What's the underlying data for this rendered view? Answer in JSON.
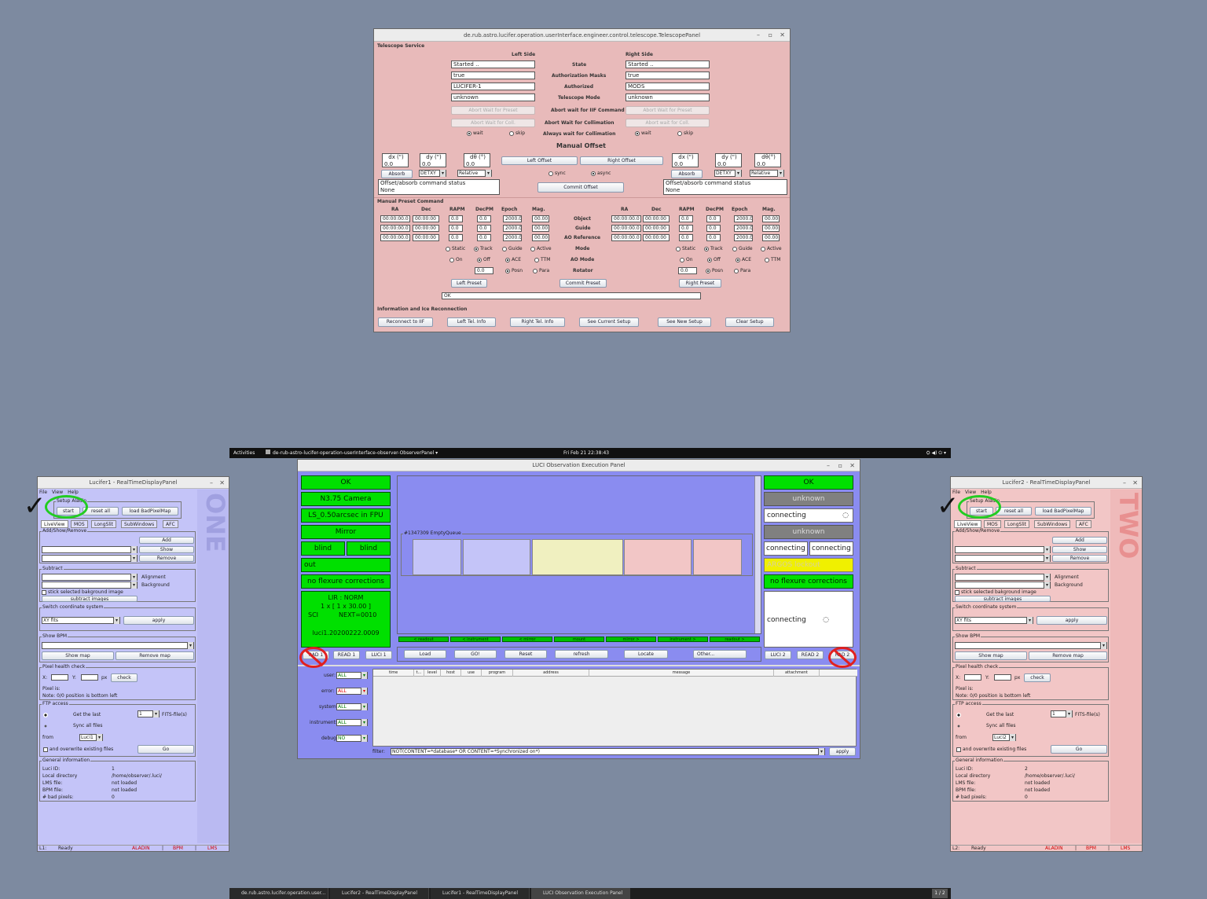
{
  "telescope": {
    "title": "de.rub.astro.lucifer.operation.userInterface.engineer.control.telescope.TelescopePanel",
    "service": "Telescope Service",
    "left_side": "Left Side",
    "right_side": "Right Side",
    "row_labels": [
      "State",
      "Authorization Masks",
      "Authorized",
      "Telescope Mode",
      "Abort wait for IIF Command",
      "Abort Wait for Collimation",
      "Always wait for Collimation"
    ],
    "left_values": [
      "Started ..",
      "true",
      "LUCIFER-1",
      "unknown"
    ],
    "right_values": [
      "Started ..",
      "true",
      "MODS",
      "unknown"
    ],
    "abort_preset": "Abort Wait for Preset",
    "abort_coll": "Abort Wait for Coll.",
    "abort_coll_r": "Abort wait for Coll.",
    "wait": "wait",
    "skip": "skip",
    "manual_offset": "Manual Offset",
    "dx": "dx (\")",
    "dy": "dy (\")",
    "dtheta": "dθ (°)",
    "dtheta_r": "dθ(°)",
    "zero": "0.0",
    "left_offset": "Left Offset",
    "right_offset": "Right Offset",
    "absorb": "Absorb",
    "detxy": "DETXY",
    "relative": "Relative",
    "sync": "sync",
    "async": "async",
    "commit_offset": "Commit Offset",
    "status_title": "Offset/absorb command status",
    "status_val": "None",
    "preset_title": "Manual Preset Command",
    "cols": [
      "RA",
      "Dec",
      "RAPM",
      "DecPM",
      "Epoch",
      "Mag."
    ],
    "rows": [
      "Object",
      "Guide",
      "AO Reference",
      "Mode",
      "AO Mode",
      "Rotator"
    ],
    "ra": "00:00:00.0",
    "dec": "00:00:00",
    "pm": "0.0",
    "epoch": "2000.0",
    "mag": "00.00",
    "modes": [
      "Static",
      "Track",
      "Guide",
      "Active"
    ],
    "aomodes": [
      "On",
      "Off",
      "ACE",
      "TTM"
    ],
    "rot": [
      "Posn",
      "Para"
    ],
    "left_preset": "Left Preset",
    "commit_preset": "Commit Preset",
    "right_preset": "Right Preset",
    "ok": "OK",
    "info_title": "Information and Ice Reconnection",
    "bottom": [
      "Reconnect to IIF",
      "Left Tel. Info",
      "Right Tel. Info",
      "See Current Setup",
      "See New Setup",
      "Clear Setup"
    ]
  },
  "topbar": {
    "activities": "Activities",
    "app": "de-rub-astro-lucifer-operation-userInterface-observer-ObserverPanel ▾",
    "clock": "Fri Feb 21  22:38:43",
    "icons": "⛭ ◀) ⏻ ▾"
  },
  "luci": {
    "title": "LUCI Observation Execution Panel",
    "left": {
      "ok": "OK",
      "camera": "N3.75 Camera",
      "mask": "LS_0.50arcsec in FPU",
      "mirror": "Mirror",
      "blind1": "blind",
      "blind2": "blind",
      "out": "out",
      "flexure": "no flexure corrections",
      "mode": "LIR : NORM",
      "exp": "1 x [ 1 x 30.00 ]",
      "sci": "SCI",
      "next": "NEXT=0010",
      "file": "luci1.20200222.0009"
    },
    "right": {
      "ok": "OK",
      "unknown1": "unknown",
      "connecting1": "connecting",
      "unknown2": "unknown",
      "connecting2": "connecting",
      "connecting3": "connecting",
      "argos": "ARGOS lockout",
      "flexure": "no flexure corrections",
      "connecting4": "connecting"
    },
    "queue": "#1347309 EmptyQueue",
    "bars": [
      "< readout",
      "< instrument",
      "< mirror",
      "mount",
      "mirror >",
      "instrument >",
      "readout >"
    ],
    "left_tabs": [
      "RAD 1",
      "READ 1",
      "LUCI 1"
    ],
    "right_tabs": [
      "LUCI 2",
      "READ 2",
      "RAD 2"
    ],
    "buttons": [
      "Load",
      "GO!",
      "Reset",
      "refresh",
      "Locate",
      "Other..."
    ],
    "log_filters": [
      {
        "label": "user:",
        "value": "ALL"
      },
      {
        "label": "error:",
        "value": "ALL"
      },
      {
        "label": "system:",
        "value": "ALL"
      },
      {
        "label": "instrument:",
        "value": "ALL"
      },
      {
        "label": "debug:",
        "value": "NO"
      }
    ],
    "log_cols": [
      "time",
      "t...",
      "level",
      "host",
      "use",
      "program",
      "address",
      "message",
      "attachment"
    ],
    "filter_label": "filter:",
    "filter_value": "NOT(CONTENT=*database* OR CONTENT=*Synchronized on*)",
    "apply": "apply"
  },
  "rt1": {
    "title": "Lucifer1 - RealTimeDisplayPanel",
    "menu": [
      "File",
      "View",
      "Help"
    ],
    "side": "ONE",
    "setup": "Setup Aladin",
    "start": "start",
    "reset": "reset all",
    "load": "load BadPixelMap",
    "tabs": [
      "LiveView",
      "MOS",
      "LongSlit",
      "SubWindows",
      "AFC"
    ],
    "addshow": "Add/Show/Remove",
    "add": "Add",
    "show": "Show",
    "remove": "Remove",
    "subtract": "Subtract",
    "alignment": "Alignment",
    "background": "Background",
    "stick": "stick selected bakground image",
    "subimg": "subtract images",
    "switch": "Switch coordinate system",
    "xyfits": "XY fits",
    "apply": "apply",
    "showbpm": "Show BPM",
    "showmap": "Show map",
    "removemap": "Remove map",
    "pixel": "Pixel health check",
    "x": "X:",
    "y": "Y:",
    "px": "px",
    "check": "check",
    "pixelis": "Pixel is:",
    "note": "Note: 0/0 position is bottom left",
    "ftp": "FTP access",
    "getlast": "Get the last",
    "one": "1",
    "fits": "FITS-file(s)",
    "syncall": "Sync all files",
    "from": "from",
    "luci": "Luci1",
    "overwrite": "and overwrite existing files",
    "go": "Go",
    "general": "General information",
    "info_labels": [
      "Luci ID:",
      "Local directory",
      "LMS file:",
      "BPM file:",
      "# bad pixels:"
    ],
    "info_values": [
      "1",
      "/home/observer/.luci/",
      "not loaded",
      "not loaded",
      "0"
    ],
    "status": "L1:",
    "ready": "Ready",
    "aladin": "ALADIN",
    "bpm": "BPM",
    "lms": "LMS"
  },
  "rt2": {
    "title": "Lucifer2 - RealTimeDisplayPanel",
    "side": "TWO",
    "luci": "Luci2",
    "status": "L2:",
    "id": "2"
  },
  "taskbar": [
    "de.rub.astro.lucifer.operation.user...",
    "Lucifer2 - RealTimeDisplayPanel",
    "Lucifer1 - RealTimeDisplayPanel",
    "LUCI Observation Execution Panel"
  ],
  "pager": "1 / 2",
  "colors": {
    "desktop": "#7d8aa0",
    "telescope_bg": "#e8baba",
    "luci_bg": "#8a8cf0",
    "green": "#00e000",
    "rt1_bg": "#c4c4f8",
    "rt2_bg": "#f2c6c6"
  }
}
